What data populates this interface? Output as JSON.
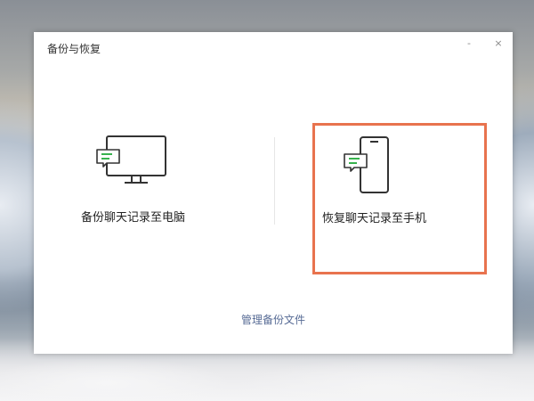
{
  "window": {
    "title": "备份与恢复",
    "minimize_label": "-",
    "close_label": "×"
  },
  "options": [
    {
      "label": "备份聊天记录至电脑",
      "icon": "desktop-chat-icon"
    },
    {
      "label": "恢复聊天记录至手机",
      "icon": "phone-chat-icon"
    }
  ],
  "manage_link": "管理备份文件",
  "colors": {
    "highlight": "#e8734e",
    "chat_bubble": "#37b24d",
    "link": "#576b95",
    "icon_stroke": "#333333"
  }
}
